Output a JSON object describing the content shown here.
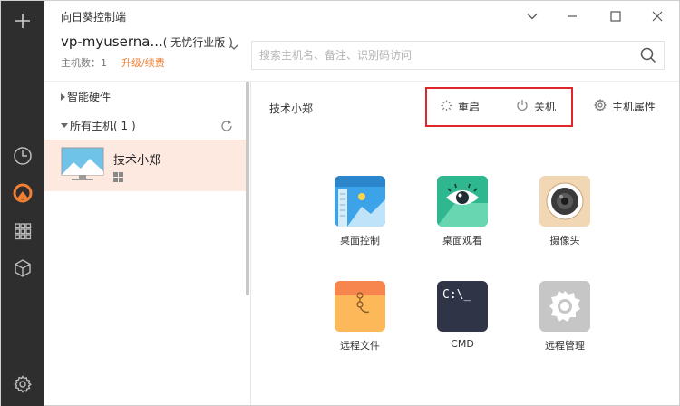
{
  "app": {
    "title": "向日葵控制端"
  },
  "account": {
    "name": "vp-myuserna...",
    "edition": "( 无忧行业版 )",
    "host_count": "主机数：1",
    "upgrade": "升级/续费"
  },
  "search": {
    "placeholder": "搜索主机名、备注、识别码访问"
  },
  "tree": {
    "smart_hardware": "智能硬件",
    "all_hosts": "所有主机( 1 )"
  },
  "hosts": [
    {
      "name": "技术小郑",
      "os_icon": "windows-icon"
    }
  ],
  "main": {
    "title": "技术小郑",
    "actions": {
      "restart": "重启",
      "shutdown": "关机",
      "properties": "主机属性"
    },
    "tiles": [
      {
        "label": "桌面控制",
        "icon": "desktop-control-icon"
      },
      {
        "label": "桌面观看",
        "icon": "desktop-view-icon"
      },
      {
        "label": "摄像头",
        "icon": "camera-icon"
      },
      {
        "label": "远程文件",
        "icon": "remote-files-icon"
      },
      {
        "label": "CMD",
        "icon": "cmd-icon",
        "glyph": "C:\\_"
      },
      {
        "label": "远程管理",
        "icon": "remote-manage-icon"
      }
    ]
  },
  "colors": {
    "rail": "#2e2e2e",
    "accent": "#f07f33",
    "selected_row": "#fde9df",
    "highlight_box": "#e0262b"
  }
}
